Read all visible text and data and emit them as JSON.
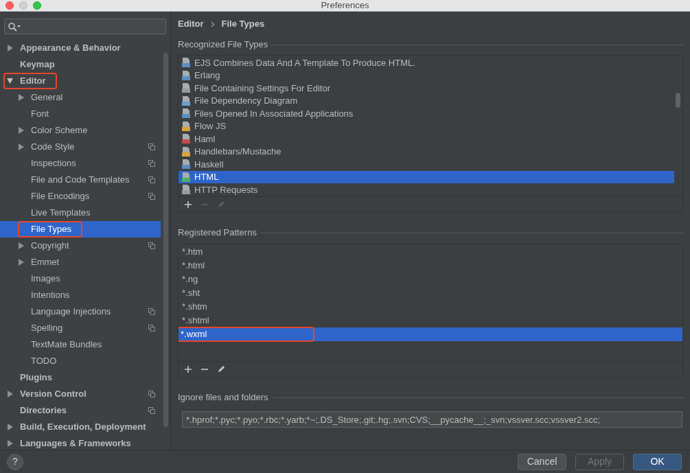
{
  "window": {
    "title": "Preferences"
  },
  "sidebar": {
    "items": [
      {
        "label": "Appearance & Behavior",
        "expanded": false,
        "selected": false,
        "highlighted": false,
        "project_scope": false
      },
      {
        "label": "Keymap",
        "selected": false,
        "highlighted": false,
        "project_scope": false
      },
      {
        "label": "Editor",
        "expanded": true,
        "selected": false,
        "highlighted": true,
        "project_scope": false,
        "children": [
          {
            "label": "General",
            "expanded": false,
            "selected": false,
            "highlighted": false,
            "project_scope": false
          },
          {
            "label": "Font",
            "selected": false,
            "highlighted": false,
            "project_scope": false
          },
          {
            "label": "Color Scheme",
            "expanded": false,
            "selected": false,
            "highlighted": false,
            "project_scope": false
          },
          {
            "label": "Code Style",
            "expanded": false,
            "selected": false,
            "highlighted": false,
            "project_scope": true
          },
          {
            "label": "Inspections",
            "selected": false,
            "highlighted": false,
            "project_scope": true
          },
          {
            "label": "File and Code Templates",
            "selected": false,
            "highlighted": false,
            "project_scope": true
          },
          {
            "label": "File Encodings",
            "selected": false,
            "highlighted": false,
            "project_scope": true
          },
          {
            "label": "Live Templates",
            "selected": false,
            "highlighted": false,
            "project_scope": false
          },
          {
            "label": "File Types",
            "selected": true,
            "highlighted": true,
            "project_scope": false
          },
          {
            "label": "Copyright",
            "expanded": false,
            "selected": false,
            "highlighted": false,
            "project_scope": true
          },
          {
            "label": "Emmet",
            "expanded": false,
            "selected": false,
            "highlighted": false,
            "project_scope": false
          },
          {
            "label": "Images",
            "selected": false,
            "highlighted": false,
            "project_scope": false
          },
          {
            "label": "Intentions",
            "selected": false,
            "highlighted": false,
            "project_scope": false
          },
          {
            "label": "Language Injections",
            "selected": false,
            "highlighted": false,
            "project_scope": true
          },
          {
            "label": "Spelling",
            "selected": false,
            "highlighted": false,
            "project_scope": true
          },
          {
            "label": "TextMate Bundles",
            "selected": false,
            "highlighted": false,
            "project_scope": false
          },
          {
            "label": "TODO",
            "selected": false,
            "highlighted": false,
            "project_scope": false
          }
        ]
      },
      {
        "label": "Plugins",
        "selected": false,
        "highlighted": false,
        "project_scope": false
      },
      {
        "label": "Version Control",
        "expanded": false,
        "selected": false,
        "highlighted": false,
        "project_scope": true
      },
      {
        "label": "Directories",
        "selected": false,
        "highlighted": false,
        "project_scope": true
      },
      {
        "label": "Build, Execution, Deployment",
        "expanded": false,
        "selected": false,
        "highlighted": false,
        "project_scope": false
      },
      {
        "label": "Languages & Frameworks",
        "expanded": false,
        "selected": false,
        "highlighted": false,
        "project_scope": false
      }
    ]
  },
  "breadcrumb": [
    "Editor",
    "File Types"
  ],
  "recognized_file_types": {
    "title": "Recognized File Types",
    "items": [
      {
        "label": "EJS Combines Data And A Template To Produce HTML.",
        "selected": false
      },
      {
        "label": "Erlang",
        "selected": false
      },
      {
        "label": "File Containing Settings For Editor",
        "selected": false
      },
      {
        "label": "File Dependency Diagram",
        "selected": false
      },
      {
        "label": "Files Opened In Associated Applications",
        "selected": false
      },
      {
        "label": "Flow JS",
        "selected": false
      },
      {
        "label": "Haml",
        "selected": false
      },
      {
        "label": "Handlebars/Mustache",
        "selected": false
      },
      {
        "label": "Haskell",
        "selected": false
      },
      {
        "label": "HTML",
        "selected": true
      },
      {
        "label": "HTTP Requests",
        "selected": false
      }
    ],
    "toolbar": [
      {
        "kind": "add",
        "disabled": false
      },
      {
        "kind": "remove",
        "disabled": true
      },
      {
        "kind": "edit",
        "disabled": true
      }
    ]
  },
  "registered_patterns": {
    "title": "Registered Patterns",
    "items": [
      {
        "label": "*.htm",
        "selected": false,
        "highlighted": false
      },
      {
        "label": "*.html",
        "selected": false,
        "highlighted": false
      },
      {
        "label": "*.ng",
        "selected": false,
        "highlighted": false
      },
      {
        "label": "*.sht",
        "selected": false,
        "highlighted": false
      },
      {
        "label": "*.shtm",
        "selected": false,
        "highlighted": false
      },
      {
        "label": "*.shtml",
        "selected": false,
        "highlighted": false
      },
      {
        "label": "*.wxml",
        "selected": true,
        "highlighted": true
      }
    ],
    "toolbar": [
      {
        "kind": "add",
        "disabled": false
      },
      {
        "kind": "remove",
        "disabled": false
      },
      {
        "kind": "edit",
        "disabled": false
      }
    ]
  },
  "ignore": {
    "title": "Ignore files and folders",
    "value": "*.hprof;*.pyc;*.pyo;*.rbc;*.yarb;*~;.DS_Store;.git;.hg;.svn;CVS;__pycache__;_svn;vssver.scc;vssver2.scc;"
  },
  "help_button": "?",
  "buttons": [
    {
      "label": "Cancel",
      "default": false,
      "disabled": false
    },
    {
      "label": "Apply",
      "default": false,
      "disabled": true
    },
    {
      "label": "OK",
      "default": true,
      "disabled": false
    }
  ]
}
